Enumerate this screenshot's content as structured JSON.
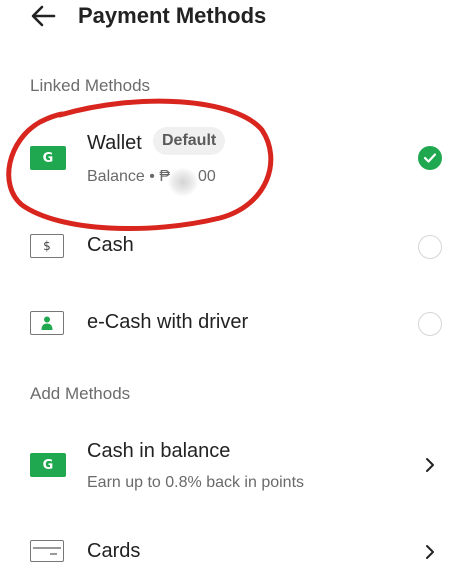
{
  "header": {
    "back_icon": "arrow-left-icon",
    "title": "Payment Methods"
  },
  "linked_methods": {
    "section_title": "Linked Methods",
    "items": [
      {
        "icon": "grab-g-icon",
        "icon_text": "G",
        "label": "Wallet",
        "badge": "Default",
        "sub": "Balance • ₱",
        "sub_tail": "00",
        "selected": true
      },
      {
        "icon": "cash-icon",
        "icon_text": "$",
        "label": "Cash",
        "selected": false
      },
      {
        "icon": "ecash-driver-icon",
        "label": "e-Cash with driver",
        "selected": false
      }
    ]
  },
  "add_methods": {
    "section_title": "Add Methods",
    "items": [
      {
        "icon": "grab-g-icon",
        "icon_text": "G",
        "label": "Cash in balance",
        "sub": "Earn up to 0.8% back in points"
      },
      {
        "icon": "card-icon",
        "label": "Cards"
      }
    ]
  },
  "colors": {
    "accent": "#1fa84f",
    "annotation": "#d8261f"
  }
}
